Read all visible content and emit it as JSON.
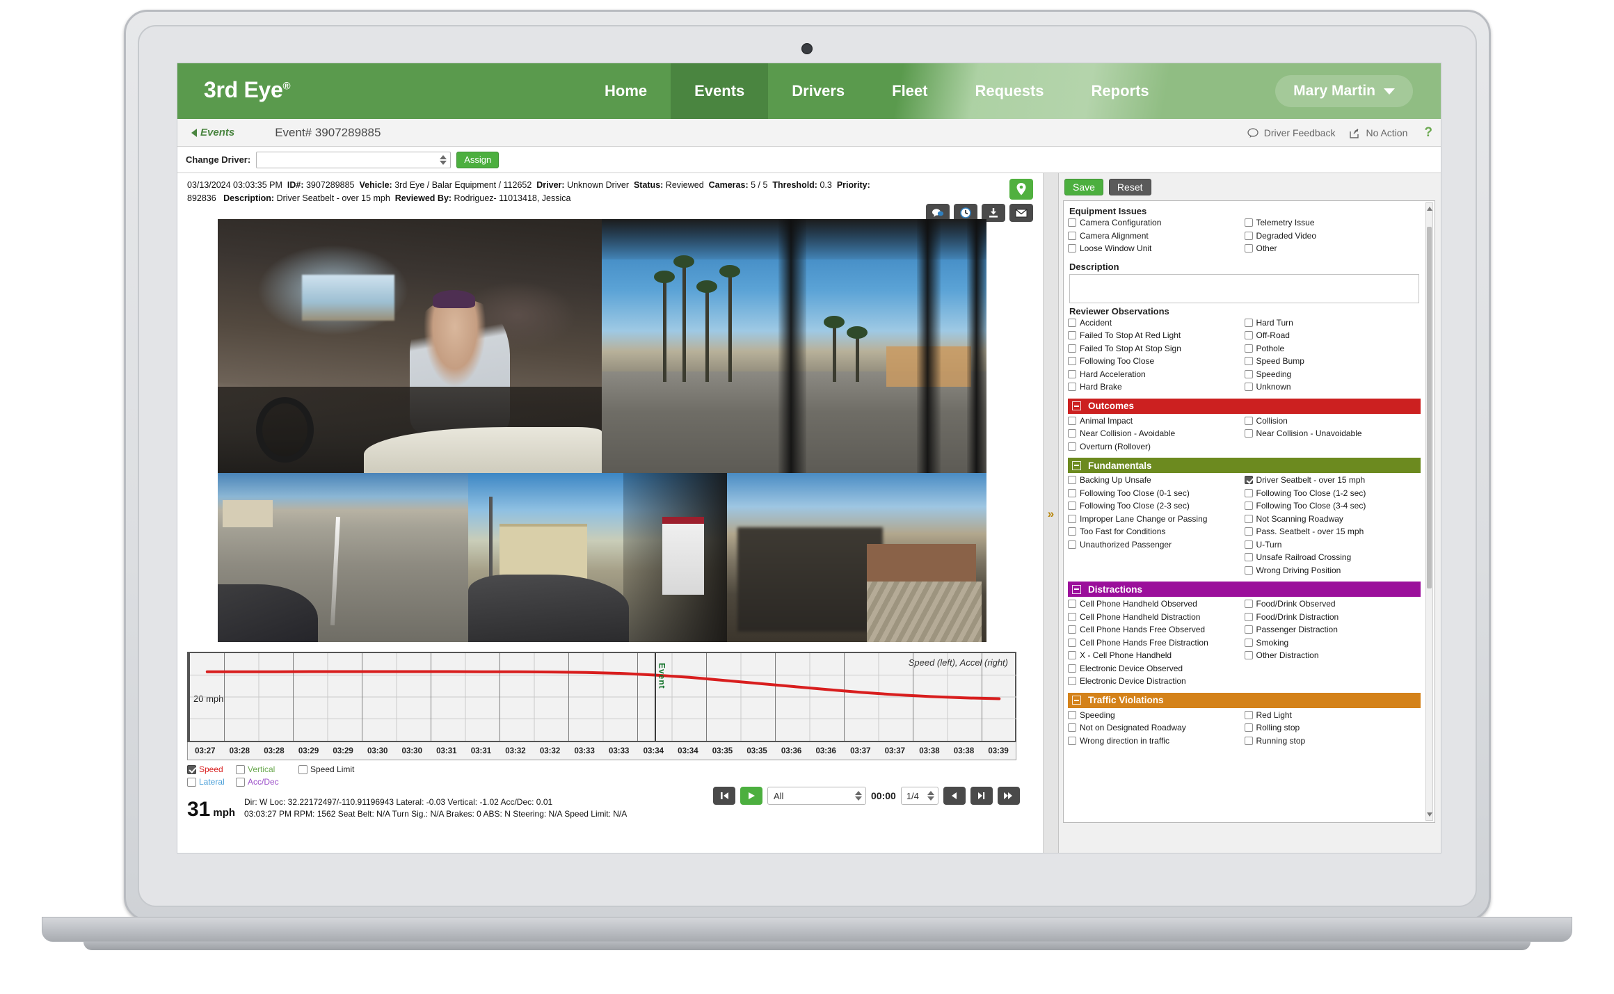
{
  "nav": {
    "brand": "3rd Eye",
    "brand_mark": "®",
    "items": [
      {
        "label": "Home",
        "active": false
      },
      {
        "label": "Events",
        "active": true
      },
      {
        "label": "Drivers",
        "active": false
      },
      {
        "label": "Fleet",
        "active": false
      },
      {
        "label": "Requests",
        "active": false
      },
      {
        "label": "Reports",
        "active": false
      }
    ],
    "user": "Mary Martin"
  },
  "breadcrumb": {
    "back_label": "Events",
    "title": "Event# 3907289885",
    "driver_feedback": "Driver Feedback",
    "no_action": "No Action",
    "help": "?"
  },
  "driver_bar": {
    "label": "Change Driver:",
    "select_value": "",
    "assign_label": "Assign"
  },
  "event_meta": {
    "datetime": "03/13/2024 03:03:35 PM",
    "id_label": "ID#:",
    "id_value": "3907289885",
    "vehicle_label": "Vehicle:",
    "vehicle_value": "3rd Eye / Balar Equipment / 112652",
    "driver_label": "Driver:",
    "driver_value": "Unknown Driver",
    "status_label": "Status:",
    "status_value": "Reviewed",
    "cameras_label": "Cameras:",
    "cameras_value": "5 / 5",
    "threshold_label": "Threshold:",
    "threshold_value": "0.3",
    "priority_label": "Priority:",
    "priority_value": "892836",
    "description_label": "Description:",
    "description_value": "Driver Seatbelt - over 15 mph",
    "reviewed_by_label": "Reviewed By:",
    "reviewed_by_value": "Rodriguez- 11013418, Jessica"
  },
  "video_tools": [
    {
      "name": "map-pin-icon",
      "glyph": "●"
    },
    {
      "name": "comment-icon",
      "glyph": "●"
    },
    {
      "name": "clock-icon",
      "glyph": "●"
    },
    {
      "name": "download-icon",
      "glyph": "●"
    },
    {
      "name": "email-icon",
      "glyph": "✉"
    }
  ],
  "chart_data": {
    "type": "line",
    "title": "",
    "annotation": "Speed (left), Accel (right)",
    "ylabel_inline": "20 mph",
    "event_marker_label": "Event",
    "xlabel": "",
    "ylim": [
      0,
      40
    ],
    "categories": [
      "03:27",
      "03:28",
      "03:28",
      "03:29",
      "03:29",
      "03:30",
      "03:30",
      "03:31",
      "03:31",
      "03:32",
      "03:32",
      "03:33",
      "03:33",
      "03:34",
      "03:34",
      "03:35",
      "03:35",
      "03:36",
      "03:36",
      "03:37",
      "03:37",
      "03:38",
      "03:38",
      "03:39"
    ],
    "series": [
      {
        "name": "Speed",
        "color": "#d81e1e",
        "values": [
          31.5,
          31.5,
          31.5,
          31.6,
          31.6,
          31.6,
          31.6,
          31.6,
          31.5,
          31.5,
          31.4,
          31.2,
          30.8,
          30.0,
          29.0,
          27.6,
          26.2,
          24.8,
          23.4,
          22.1,
          21.0,
          20.2,
          19.6,
          19.2
        ]
      }
    ],
    "event_at_index": 13,
    "grid": true
  },
  "chart_legend": {
    "items": [
      {
        "label": "Speed",
        "color": "#d81e1e",
        "checked": true
      },
      {
        "label": "Vertical",
        "color": "#6aa84f",
        "checked": false
      },
      {
        "label": "Speed Limit",
        "color": "#222222",
        "checked": false
      },
      {
        "label": "Lateral",
        "color": "#4a9fd8",
        "checked": false
      },
      {
        "label": "Acc/Dec",
        "color": "#9b4fc8",
        "checked": false
      }
    ]
  },
  "playback": {
    "to_start_label": "⏮",
    "play_label": "▶",
    "camera_select": "All",
    "time": "00:00",
    "speed_select": "1/4",
    "step_back_label": "◀",
    "step_fwd_label": "▶",
    "fast_fwd_label": "▶▶"
  },
  "telemetry": {
    "speed_value": "31",
    "speed_unit": "mph",
    "line1": "Dir: W  Loc: 32.22172497/-110.91196943  Lateral: -0.03  Vertical: -1.02  Acc/Dec: 0.01",
    "line2": "03:03:27 PM  RPM: 1562  Seat Belt: N/A  Turn Sig.: N/A  Brakes: 0  ABS: N  Steering: N/A  Speed Limit: N/A"
  },
  "review_panel": {
    "save_label": "Save",
    "reset_label": "Reset",
    "sections": [
      {
        "title": "Equipment Issues",
        "type": "plain",
        "left": [
          "Camera Configuration",
          "Camera Alignment",
          "Loose Window Unit"
        ],
        "right": [
          "Telemetry Issue",
          "Degraded Video",
          "Other"
        ]
      }
    ],
    "description_label": "Description",
    "description_value": "",
    "observations": {
      "title": "Reviewer Observations",
      "left": [
        "Accident",
        "Failed To Stop At Red Light",
        "Failed To Stop At Stop Sign",
        "Following Too Close",
        "Hard Acceleration",
        "Hard Brake"
      ],
      "right": [
        "Hard Turn",
        "Off-Road",
        "Pothole",
        "Speed Bump",
        "Speeding",
        "Unknown"
      ]
    },
    "categories": [
      {
        "title": "Outcomes",
        "color": "#cc2020",
        "left": [
          "Animal Impact",
          "Near Collision - Avoidable",
          "Overturn (Rollover)"
        ],
        "right": [
          "Collision",
          "Near Collision - Unavoidable"
        ],
        "checked": []
      },
      {
        "title": "Fundamentals",
        "color": "#6c8a1f",
        "left": [
          "Backing Up Unsafe",
          "Following Too Close (0-1 sec)",
          "Following Too Close (2-3 sec)",
          "Improper Lane Change or Passing",
          "Too Fast for Conditions",
          "Unauthorized Passenger"
        ],
        "right": [
          "Driver Seatbelt - over 15 mph",
          "Following Too Close (1-2 sec)",
          "Following Too Close (3-4 sec)",
          "Not Scanning Roadway",
          "Pass. Seatbelt - over 15 mph",
          "U-Turn",
          "Unsafe Railroad Crossing",
          "Wrong Driving Position"
        ],
        "checked": [
          "Driver Seatbelt - over 15 mph"
        ]
      },
      {
        "title": "Distractions",
        "color": "#9b0f9b",
        "left": [
          "Cell Phone Handheld Observed",
          "Cell Phone Handheld Distraction",
          "Cell Phone Hands Free Observed",
          "Cell Phone Hands Free Distraction",
          "X - Cell Phone Handheld",
          "Electronic Device Observed",
          "Electronic Device Distraction"
        ],
        "right": [
          "Food/Drink Observed",
          "Food/Drink Distraction",
          "Passenger Distraction",
          "Smoking",
          "Other Distraction"
        ],
        "checked": []
      },
      {
        "title": "Traffic Violations",
        "color": "#d4821a",
        "left": [
          "Speeding",
          "Not on Designated Roadway",
          "Wrong direction in traffic"
        ],
        "right": [
          "Red Light",
          "Rolling stop",
          "Running stop"
        ],
        "checked": []
      }
    ]
  },
  "colors": {
    "brand_green": "#5a9a4d",
    "nav_active": "#4a8540",
    "save_green": "#4caf3f",
    "speed_line": "#d81e1e"
  }
}
